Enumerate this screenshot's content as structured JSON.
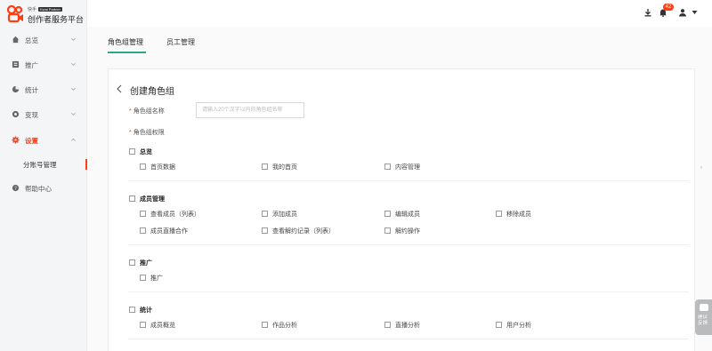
{
  "brand": {
    "small_text": "快手",
    "badge": "Kwai Partner",
    "title": "创作者服务平台",
    "accent": "#fe3e14"
  },
  "sidebar": {
    "items": [
      {
        "label": "总览",
        "icon": "home-icon",
        "expanded": false
      },
      {
        "label": "推广",
        "icon": "promotion-icon",
        "expanded": false
      },
      {
        "label": "统计",
        "icon": "stats-icon",
        "expanded": false
      },
      {
        "label": "变现",
        "icon": "monetize-icon",
        "expanded": false
      },
      {
        "label": "设置",
        "icon": "gear-icon",
        "expanded": true,
        "active": true
      },
      {
        "label": "帮助中心",
        "icon": "help-icon"
      }
    ],
    "sub_items": [
      {
        "label": "分账号管理",
        "active": true
      }
    ]
  },
  "topbar": {
    "notification_count": "42",
    "icons": [
      "download-icon",
      "bell-icon",
      "user-icon",
      "caret-down-icon"
    ]
  },
  "tabs": [
    {
      "label": "角色组管理",
      "active": true
    },
    {
      "label": "员工管理",
      "active": false
    }
  ],
  "form": {
    "title": "创建角色组",
    "name_label": "角色组名称",
    "name_placeholder": "请输入20个汉字以内的角色组名称",
    "name_value": "",
    "permission_label": "角色组权限",
    "required_mark": "*"
  },
  "permission_groups": [
    {
      "label": "总览",
      "checked": false,
      "items": [
        {
          "label": "首页数据",
          "checked": false
        },
        {
          "label": "我的首页",
          "checked": false
        },
        {
          "label": "内容管理",
          "checked": false
        }
      ]
    },
    {
      "label": "成员管理",
      "checked": false,
      "items": [
        {
          "label": "查看成员（列表）",
          "checked": false
        },
        {
          "label": "添加成员",
          "checked": false
        },
        {
          "label": "编辑成员",
          "checked": false
        },
        {
          "label": "移除成员",
          "checked": false
        },
        {
          "label": "成员直播合作",
          "checked": false
        },
        {
          "label": "查看解约记录（列表）",
          "checked": false
        },
        {
          "label": "解约操作",
          "checked": false
        }
      ]
    },
    {
      "label": "推广",
      "checked": false,
      "items": [
        {
          "label": "推广",
          "checked": false
        }
      ]
    },
    {
      "label": "统计",
      "checked": false,
      "items": [
        {
          "label": "成员概览",
          "checked": false
        },
        {
          "label": "作品分析",
          "checked": false
        },
        {
          "label": "直播分析",
          "checked": false
        },
        {
          "label": "用户分析",
          "checked": false
        }
      ]
    }
  ],
  "floating": {
    "label": "建议反馈"
  }
}
